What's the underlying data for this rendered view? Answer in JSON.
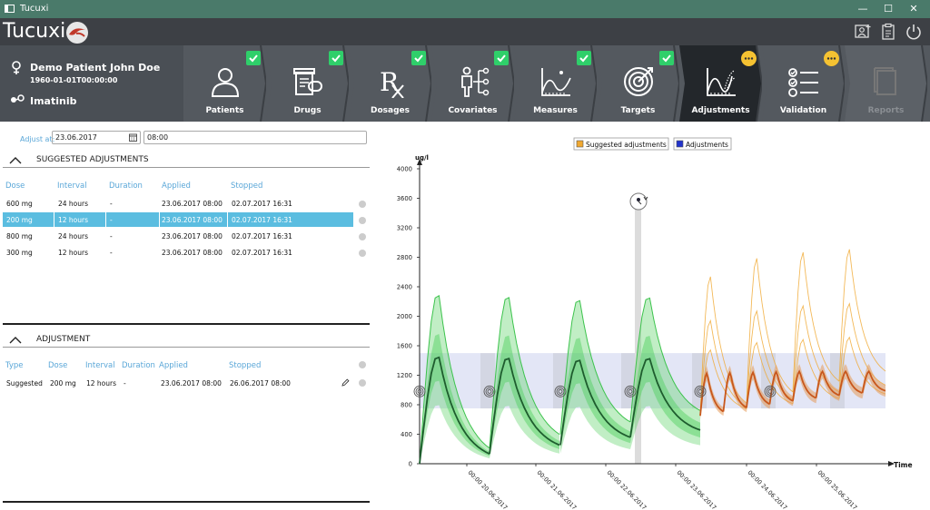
{
  "window": {
    "title": "Tucuxi",
    "min": "—",
    "max": "☐",
    "close": "✕"
  },
  "header": {
    "logo_text": "Tucuxi"
  },
  "patient": {
    "name": "Demo Patient John Doe",
    "birth": "1960-01-01T00:00:00",
    "drug": "Imatinib"
  },
  "steps": [
    {
      "label": "Patients",
      "status": "done",
      "icon": "patient-icon"
    },
    {
      "label": "Drugs",
      "status": "done",
      "icon": "drugs-icon"
    },
    {
      "label": "Dosages",
      "status": "done",
      "icon": "rx-icon"
    },
    {
      "label": "Covariates",
      "status": "done",
      "icon": "covariates-icon"
    },
    {
      "label": "Measures",
      "status": "done",
      "icon": "measures-icon"
    },
    {
      "label": "Targets",
      "status": "done",
      "icon": "target-icon"
    },
    {
      "label": "Adjustments",
      "status": "pending",
      "icon": "adjustments-icon"
    },
    {
      "label": "Validation",
      "status": "pending",
      "icon": "validation-icon"
    },
    {
      "label": "Reports",
      "status": "disabled",
      "icon": "reports-icon"
    }
  ],
  "adjust_at": {
    "label": "Adjust at:",
    "date": "23.06.2017",
    "time": "08:00"
  },
  "suggested": {
    "title": "SUGGESTED ADJUSTMENTS",
    "columns": [
      "Dose",
      "Interval",
      "Duration",
      "Applied",
      "Stopped"
    ],
    "rows": [
      [
        "600 mg",
        "24 hours",
        "-",
        "23.06.2017 08:00",
        "02.07.2017 16:31"
      ],
      [
        "200 mg",
        "12 hours",
        "-",
        "23.06.2017 08:00",
        "02.07.2017 16:31"
      ],
      [
        "800 mg",
        "24 hours",
        "-",
        "23.06.2017 08:00",
        "02.07.2017 16:31"
      ],
      [
        "300 mg",
        "12 hours",
        "-",
        "23.06.2017 08:00",
        "02.07.2017 16:31"
      ]
    ],
    "selected_row": 1
  },
  "adjustment": {
    "title": "ADJUSTMENT",
    "columns": [
      "Type",
      "Dose",
      "Interval",
      "Duration",
      "Applied",
      "Stopped"
    ],
    "row": [
      "Suggested",
      "200 mg",
      "12 hours",
      "-",
      "23.06.2017 08:00",
      "26.06.2017 08:00"
    ]
  },
  "chart_data": {
    "type": "line",
    "legend": [
      "Suggested adjustments",
      "Adjustments"
    ],
    "legend_colors": [
      "#f0a830",
      "#2233cc"
    ],
    "ylabel": "ug/l",
    "xlabel": "Time",
    "ylim": [
      0,
      4000
    ],
    "yticks": [
      0,
      400,
      800,
      1200,
      1600,
      2000,
      2400,
      2800,
      3200,
      3600,
      4000
    ],
    "xticks": [
      "00:00 20.06.2017",
      "00:00 21.06.2017",
      "00:00 22.06.2017",
      "00:00 23.06.2017",
      "00:00 24.06.2017",
      "00:00 25.06.2017"
    ],
    "target_range": [
      750,
      1500
    ],
    "peaks_history": [
      1480,
      1460,
      1430,
      1450
    ],
    "troughs_history": [
      430,
      480,
      640,
      660
    ],
    "colors": {
      "history": "#1e5c2e",
      "history_band": "#4ccf5a",
      "suggested": "#f0a830",
      "selected": "#c8571c"
    }
  }
}
